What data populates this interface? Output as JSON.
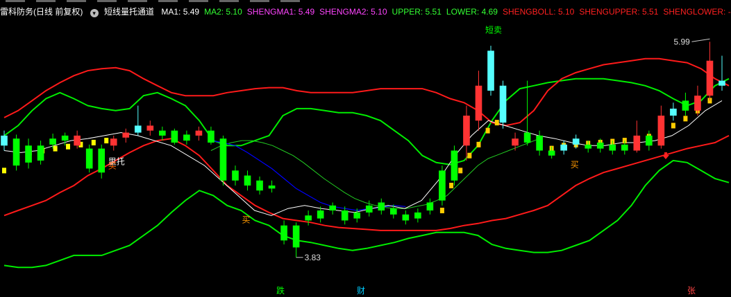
{
  "header": {
    "stock": "雷科防务(日线 前复权)",
    "indicator": "短线量托通道",
    "items": [
      {
        "label": "MA1: 5.49",
        "color": "#ffffff"
      },
      {
        "label": "MA2: 5.10",
        "color": "#33ff33"
      },
      {
        "label": "SHENGMA1: 5.49",
        "color": "#ff44ff"
      },
      {
        "label": "SHENGMA2: 5.10",
        "color": "#ff44ff"
      },
      {
        "label": "UPPER: 5.51",
        "color": "#33ff33"
      },
      {
        "label": "LOWER: 4.69",
        "color": "#33ff33"
      },
      {
        "label": "SHENGBOLL: 5.10",
        "color": "#ff2020"
      },
      {
        "label": "SHENGUPPER: 5.51",
        "color": "#ff2020"
      },
      {
        "label": "SHENGLOWER: -",
        "color": "#ff2020"
      }
    ]
  },
  "colors": {
    "up": "#ff3333",
    "down": "#00ff00",
    "cyan": "#55ffff",
    "band": "#ff1a1a",
    "bandGreen": "#00ee00",
    "ma1": "#ffffff",
    "ma2": "#0000ff",
    "yellow": "#ffff00",
    "gold": "#ffcc00"
  },
  "chart_data": {
    "type": "candlestick",
    "ylim": [
      3.6,
      6.2
    ],
    "high_marker": {
      "index": 58,
      "value": 5.99,
      "label": "5.99"
    },
    "low_marker": {
      "index": 24,
      "value": 3.83,
      "label": "3.83"
    },
    "candles": [
      {
        "o": 4.95,
        "c": 5.05,
        "h": 5.1,
        "l": 4.9,
        "cl": "cyan"
      },
      {
        "o": 5.02,
        "c": 4.75,
        "h": 5.06,
        "l": 4.7,
        "cl": "down"
      },
      {
        "o": 4.78,
        "c": 4.95,
        "h": 5.02,
        "l": 4.72,
        "cl": "down"
      },
      {
        "o": 4.95,
        "c": 4.8,
        "h": 5.0,
        "l": 4.76,
        "cl": "down"
      },
      {
        "o": 4.96,
        "c": 5.02,
        "h": 5.07,
        "l": 4.92,
        "cl": "down"
      },
      {
        "o": 5.0,
        "c": 5.05,
        "h": 5.08,
        "l": 4.95,
        "cl": "down"
      },
      {
        "o": 4.95,
        "c": 5.05,
        "h": 5.1,
        "l": 4.92,
        "cl": "up"
      },
      {
        "o": 4.92,
        "c": 4.72,
        "h": 4.96,
        "l": 4.68,
        "cl": "down"
      },
      {
        "o": 4.92,
        "c": 4.68,
        "h": 4.96,
        "l": 4.62,
        "cl": "down"
      },
      {
        "o": 4.95,
        "c": 5.02,
        "h": 5.05,
        "l": 4.9,
        "cl": "up"
      },
      {
        "o": 5.03,
        "c": 5.08,
        "h": 5.12,
        "l": 4.98,
        "cl": "up"
      },
      {
        "o": 5.08,
        "c": 5.15,
        "h": 5.35,
        "l": 5.05,
        "cl": "cyan"
      },
      {
        "o": 5.1,
        "c": 5.15,
        "h": 5.2,
        "l": 5.05,
        "cl": "up"
      },
      {
        "o": 5.1,
        "c": 5.05,
        "h": 5.14,
        "l": 5.0,
        "cl": "down"
      },
      {
        "o": 5.1,
        "c": 4.98,
        "h": 5.12,
        "l": 4.96,
        "cl": "down"
      },
      {
        "o": 5.0,
        "c": 5.06,
        "h": 5.1,
        "l": 4.96,
        "cl": "down"
      },
      {
        "o": 5.05,
        "c": 5.1,
        "h": 5.14,
        "l": 5.0,
        "cl": "up"
      },
      {
        "o": 5.1,
        "c": 4.98,
        "h": 5.14,
        "l": 4.96,
        "cl": "down"
      },
      {
        "o": 5.02,
        "c": 4.6,
        "h": 5.05,
        "l": 4.55,
        "cl": "down"
      },
      {
        "o": 4.7,
        "c": 4.6,
        "h": 4.75,
        "l": 4.55,
        "cl": "down"
      },
      {
        "o": 4.65,
        "c": 4.55,
        "h": 4.7,
        "l": 4.5,
        "cl": "down"
      },
      {
        "o": 4.6,
        "c": 4.5,
        "h": 4.64,
        "l": 4.46,
        "cl": "down"
      },
      {
        "o": 4.55,
        "c": 4.52,
        "h": 4.6,
        "l": 4.48,
        "cl": "down"
      },
      {
        "o": 4.15,
        "c": 4.0,
        "h": 4.2,
        "l": 3.96,
        "cl": "down"
      },
      {
        "o": 4.15,
        "c": 3.93,
        "h": 4.18,
        "l": 3.83,
        "cl": "down"
      },
      {
        "o": 4.25,
        "c": 4.2,
        "h": 4.3,
        "l": 4.15,
        "cl": "down"
      },
      {
        "o": 4.22,
        "c": 4.3,
        "h": 4.34,
        "l": 4.18,
        "cl": "down"
      },
      {
        "o": 4.3,
        "c": 4.35,
        "h": 4.38,
        "l": 4.26,
        "cl": "down"
      },
      {
        "o": 4.3,
        "c": 4.2,
        "h": 4.34,
        "l": 4.16,
        "cl": "down"
      },
      {
        "o": 4.22,
        "c": 4.28,
        "h": 4.32,
        "l": 4.18,
        "cl": "down"
      },
      {
        "o": 4.28,
        "c": 4.35,
        "h": 4.4,
        "l": 4.24,
        "cl": "down"
      },
      {
        "o": 4.3,
        "c": 4.38,
        "h": 4.42,
        "l": 4.26,
        "cl": "down"
      },
      {
        "o": 4.32,
        "c": 4.26,
        "h": 4.36,
        "l": 4.22,
        "cl": "down"
      },
      {
        "o": 4.26,
        "c": 4.2,
        "h": 4.3,
        "l": 4.16,
        "cl": "down"
      },
      {
        "o": 4.22,
        "c": 4.28,
        "h": 4.32,
        "l": 4.18,
        "cl": "down"
      },
      {
        "o": 4.3,
        "c": 4.38,
        "h": 4.42,
        "l": 4.26,
        "cl": "down"
      },
      {
        "o": 4.4,
        "c": 4.7,
        "h": 4.75,
        "l": 4.35,
        "cl": "down"
      },
      {
        "o": 4.6,
        "c": 4.9,
        "h": 4.95,
        "l": 4.55,
        "cl": "down"
      },
      {
        "o": 4.95,
        "c": 5.25,
        "h": 5.35,
        "l": 4.8,
        "cl": "up"
      },
      {
        "o": 5.2,
        "c": 5.55,
        "h": 5.7,
        "l": 5.1,
        "cl": "up"
      },
      {
        "o": 5.5,
        "c": 5.9,
        "h": 5.95,
        "l": 5.45,
        "cl": "cyan"
      },
      {
        "o": 5.55,
        "c": 5.18,
        "h": 5.6,
        "l": 5.12,
        "cl": "cyan"
      },
      {
        "o": 5.02,
        "c": 4.95,
        "h": 5.08,
        "l": 4.9,
        "cl": "up"
      },
      {
        "o": 4.98,
        "c": 5.08,
        "h": 5.6,
        "l": 4.95,
        "cl": "down"
      },
      {
        "o": 5.05,
        "c": 4.9,
        "h": 5.1,
        "l": 4.85,
        "cl": "down"
      },
      {
        "o": 4.9,
        "c": 4.85,
        "h": 4.94,
        "l": 4.82,
        "cl": "down"
      },
      {
        "o": 4.9,
        "c": 4.96,
        "h": 5.0,
        "l": 4.86,
        "cl": "cyan"
      },
      {
        "o": 4.96,
        "c": 5.02,
        "h": 5.06,
        "l": 4.92,
        "cl": "cyan"
      },
      {
        "o": 4.96,
        "c": 4.92,
        "h": 5.0,
        "l": 4.88,
        "cl": "down"
      },
      {
        "o": 4.92,
        "c": 4.98,
        "h": 5.02,
        "l": 4.88,
        "cl": "down"
      },
      {
        "o": 4.96,
        "c": 4.9,
        "h": 5.0,
        "l": 4.86,
        "cl": "down"
      },
      {
        "o": 4.9,
        "c": 4.96,
        "h": 5.0,
        "l": 4.86,
        "cl": "down"
      },
      {
        "o": 4.9,
        "c": 5.05,
        "h": 5.2,
        "l": 4.88,
        "cl": "up"
      },
      {
        "o": 5.05,
        "c": 4.95,
        "h": 5.1,
        "l": 4.9,
        "cl": "down"
      },
      {
        "o": 4.95,
        "c": 5.25,
        "h": 5.35,
        "l": 4.92,
        "cl": "up"
      },
      {
        "o": 5.25,
        "c": 5.32,
        "h": 5.38,
        "l": 5.2,
        "cl": "cyan"
      },
      {
        "o": 5.3,
        "c": 5.4,
        "h": 5.48,
        "l": 5.25,
        "cl": "down"
      },
      {
        "o": 5.3,
        "c": 5.45,
        "h": 5.55,
        "l": 5.25,
        "cl": "up"
      },
      {
        "o": 5.45,
        "c": 5.8,
        "h": 5.99,
        "l": 5.4,
        "cl": "up"
      },
      {
        "o": 5.6,
        "c": 5.55,
        "h": 5.85,
        "l": 5.5,
        "cl": "cyan"
      }
    ],
    "signals": [
      {
        "index": 9,
        "text": "里托",
        "value": 4.76,
        "color": "#ffffff"
      },
      {
        "index": 9,
        "text": "买",
        "value": 4.72,
        "color": "#ff6600"
      },
      {
        "index": 20,
        "text": "买",
        "value": 4.18,
        "color": "#ff9900"
      },
      {
        "index": 40,
        "text": "短卖",
        "value": 6.08,
        "color": "#00ff00"
      },
      {
        "index": 47,
        "text": "买",
        "value": 4.73,
        "color": "#ff9900"
      }
    ],
    "bottom_labels": [
      {
        "x": 398,
        "text": "跌",
        "color": "#00ff00"
      },
      {
        "x": 514,
        "text": "财",
        "color": "#00ccff"
      },
      {
        "x": 990,
        "text": "张",
        "color": "#ff4444"
      }
    ],
    "upper_band": [
      5.05,
      5.15,
      5.3,
      5.42,
      5.48,
      5.42,
      5.35,
      5.32,
      5.3,
      5.32,
      5.45,
      5.48,
      5.42,
      5.35,
      5.2,
      5.0,
      4.95,
      4.95,
      5.0,
      5.05,
      5.25,
      5.32,
      5.32,
      5.3,
      5.28,
      5.28,
      5.25,
      5.2,
      5.1,
      5.0,
      4.85,
      4.78,
      4.76,
      4.8,
      4.95,
      5.2,
      5.4,
      5.52,
      5.55,
      5.58,
      5.6,
      5.62,
      5.62,
      5.62,
      5.6,
      5.58,
      5.55,
      5.5,
      5.42,
      5.35,
      5.4,
      5.55,
      5.62
    ],
    "lower_band": [
      3.75,
      3.73,
      3.73,
      3.75,
      3.8,
      3.85,
      3.85,
      3.85,
      3.9,
      3.95,
      4.05,
      4.15,
      4.28,
      4.4,
      4.5,
      4.45,
      4.35,
      4.3,
      4.2,
      4.15,
      4.05,
      4.0,
      3.98,
      3.95,
      3.92,
      3.9,
      3.92,
      3.95,
      3.98,
      4.02,
      4.05,
      4.08,
      4.08,
      4.08,
      4.05,
      3.96,
      3.92,
      3.9,
      3.88,
      3.88,
      3.9,
      3.95,
      4.0,
      4.1,
      4.2,
      4.35,
      4.55,
      4.7,
      4.8,
      4.78,
      4.7,
      4.62,
      4.58
    ],
    "red_lower": [
      4.25,
      4.3,
      4.35,
      4.4,
      4.48,
      4.55,
      4.65,
      4.72,
      4.8,
      4.88,
      4.95,
      5.0,
      5.02,
      4.95,
      4.85,
      4.7,
      4.55,
      4.45,
      4.35,
      4.28,
      4.22,
      4.2,
      4.18,
      4.15,
      4.13,
      4.12,
      4.11,
      4.1,
      4.1,
      4.1,
      4.1,
      4.1,
      4.12,
      4.15,
      4.17,
      4.2,
      4.22,
      4.26,
      4.3,
      4.35,
      4.45,
      4.55,
      4.62,
      4.68,
      4.72,
      4.76,
      4.8,
      4.84,
      4.88,
      4.92,
      4.95,
      4.98,
      5.05
    ],
    "red_upper": [
      5.23,
      5.3,
      5.4,
      5.5,
      5.58,
      5.65,
      5.7,
      5.72,
      5.73,
      5.7,
      5.62,
      5.55,
      5.48,
      5.45,
      5.45,
      5.45,
      5.48,
      5.5,
      5.52,
      5.53,
      5.53,
      5.5,
      5.48,
      5.48,
      5.48,
      5.48,
      5.5,
      5.52,
      5.52,
      5.52,
      5.52,
      5.48,
      5.42,
      5.38,
      5.3,
      5.18,
      5.15,
      5.18,
      5.3,
      5.5,
      5.62,
      5.68,
      5.72,
      5.76,
      5.78,
      5.8,
      5.82,
      5.82,
      5.8,
      5.78,
      5.72,
      5.62,
      5.55
    ],
    "green_mid": [
      4.9,
      4.95,
      4.98,
      5.0,
      5.0,
      4.98,
      4.95,
      4.9,
      4.85,
      4.78,
      4.7,
      4.62,
      4.55,
      4.48,
      4.42,
      4.38,
      4.35,
      4.33,
      4.32,
      4.32,
      4.34,
      4.36,
      4.4,
      4.45,
      4.55,
      4.65,
      4.75,
      4.82,
      4.86,
      4.9,
      4.94,
      4.98,
      5.02
    ],
    "ma1": [
      4.9,
      4.88,
      4.9,
      4.95,
      5.0,
      5.02,
      5.05,
      5.08,
      5.05,
      5.0,
      4.95,
      4.85,
      4.75,
      4.6,
      4.45,
      4.3,
      4.25,
      4.32,
      4.35,
      4.32,
      4.3,
      4.28,
      4.32,
      4.35,
      4.32,
      4.4,
      4.6,
      4.85,
      5.05,
      5.2,
      5.15,
      5.1,
      5.05,
      5.02,
      4.98,
      4.95,
      4.95,
      4.98,
      4.98,
      5.0,
      5.05,
      5.15,
      5.3,
      5.4
    ],
    "ma2_blue": [
      5.0,
      4.98,
      4.95,
      4.88,
      4.8,
      4.72,
      4.62,
      4.52,
      4.45,
      4.38,
      4.34,
      4.32,
      4.3,
      4.32,
      4.33,
      4.35,
      4.34
    ],
    "yellow_dots": [
      4.7,
      4.86,
      4.88,
      4.9,
      4.92,
      4.94,
      4.96,
      4.98,
      5.0,
      4.3,
      4.55,
      4.7,
      4.85,
      4.96,
      5.1,
      5.18,
      4.92,
      4.95,
      4.96,
      4.97,
      4.98,
      4.99,
      5.0,
      5.02,
      5.04,
      5.08,
      5.15,
      5.22,
      5.3,
      5.4
    ]
  }
}
